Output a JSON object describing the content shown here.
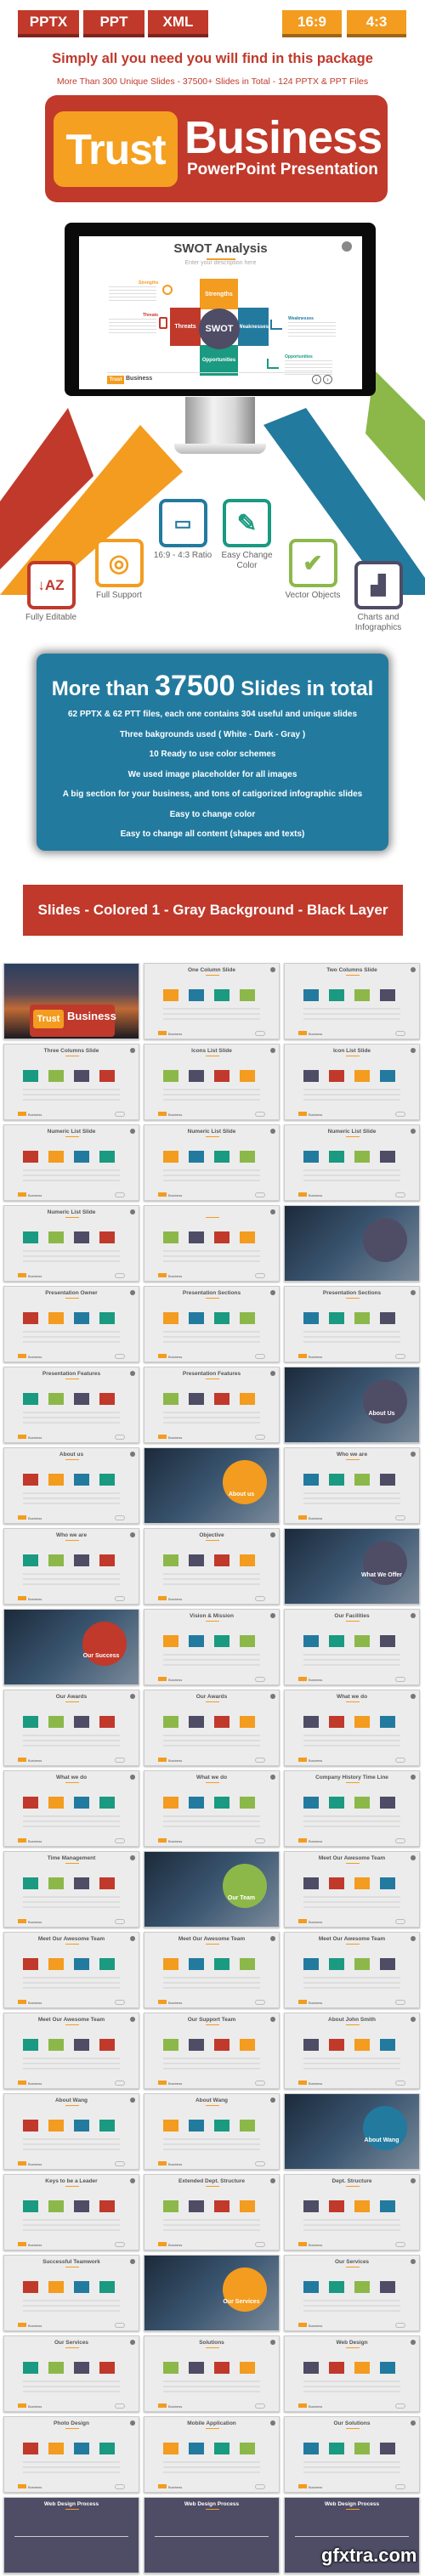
{
  "format_badges": [
    {
      "label": "PPTX",
      "color": "#c0392b"
    },
    {
      "label": "PPT",
      "color": "#c0392b"
    },
    {
      "label": "XML",
      "color": "#c0392b"
    }
  ],
  "ratio_badges": [
    {
      "label": "16:9",
      "color": "#f39c1f"
    },
    {
      "label": "4:3",
      "color": "#f39c1f"
    }
  ],
  "headline": "Simply all you need you will find in this package",
  "subheadline": "More Than 300 Unique Slides - 37500+ Slides in Total - 124 PPTX & PPT Files",
  "logo": {
    "word1": "Trust",
    "word2": "Business",
    "tagline": "PowerPoint Presentation"
  },
  "colors": {
    "red": "#c0392b",
    "orange": "#f39c1f",
    "blue": "#237a9f",
    "teal": "#1a9a80",
    "green": "#8cb84a",
    "navy": "#4f4c66"
  },
  "monitor_slide": {
    "title": "SWOT Analysis",
    "subtitle": "Enter your description here",
    "center": "SWOT",
    "blocks": {
      "top": "Strengths",
      "left": "Threats",
      "right": "Weaknesses",
      "bottom": "Opportunities"
    },
    "side_labels": {
      "strengths": "Strengths",
      "threats": "Threats",
      "weaknesses": "Weaknesses",
      "opportunities": "Opportunities"
    },
    "footer_logo_word1": "Trust",
    "footer_logo_word2": "Business"
  },
  "features": [
    {
      "icon": "sort-az-icon",
      "label": "Fully Editable",
      "color": "#c0392b"
    },
    {
      "icon": "lifebuoy-icon",
      "label": "Full Support",
      "color": "#f39c1f"
    },
    {
      "icon": "laptop-icon",
      "label": "16:9 - 4:3 Ratio",
      "color": "#237a9f"
    },
    {
      "icon": "paintbrush-icon",
      "label": "Easy Change Color",
      "color": "#1a9a80"
    },
    {
      "icon": "checkmark-icon",
      "label": "Vector Objects",
      "color": "#8cb84a"
    },
    {
      "icon": "bar-chart-icon",
      "label": "Charts and Infographics",
      "color": "#4f4c66"
    }
  ],
  "info_box": {
    "title_pre": "More than",
    "title_number": "37500",
    "title_post": "Slides in total",
    "lines": [
      "62 PPTX & 62 PTT files, each one contains 304 useful and unique slides",
      "Three bakgrounds used  ( White - Dark - Gray )",
      "10 Ready to use color schemes",
      "We used image placeholder for all images",
      "A big section for your business, and tons of catigorized infographic slides",
      "Easy to change color",
      "Easy to change all content (shapes and texts)"
    ]
  },
  "section_title": "Slides - Colored 1 - Gray Background - Black Layer",
  "slides": [
    {
      "title": "",
      "kind": "cover"
    },
    {
      "title": "One Column Slide"
    },
    {
      "title": "Two Columns Slide"
    },
    {
      "title": "Three Columns Slide"
    },
    {
      "title": "Icons List Slide"
    },
    {
      "title": "Icon List Slide"
    },
    {
      "title": "Numeric List Slide"
    },
    {
      "title": "Numeric List Slide"
    },
    {
      "title": "Numeric List Slide"
    },
    {
      "title": "Numeric List Slide"
    },
    {
      "title": ""
    },
    {
      "title": "",
      "kind": "photo"
    },
    {
      "title": "Presentation Owner"
    },
    {
      "title": "Presentation Sections"
    },
    {
      "title": "Presentation Sections"
    },
    {
      "title": "Presentation Features"
    },
    {
      "title": "Presentation Features"
    },
    {
      "title": "About Us",
      "kind": "photo"
    },
    {
      "title": "About us"
    },
    {
      "title": "About us",
      "kind": "photo"
    },
    {
      "title": "Who we are"
    },
    {
      "title": "Who we are"
    },
    {
      "title": "Objective"
    },
    {
      "title": "What We Offer",
      "kind": "photo"
    },
    {
      "title": "Our Success",
      "kind": "photo"
    },
    {
      "title": "Vision & Mission"
    },
    {
      "title": "Our Facilities"
    },
    {
      "title": "Our Awards"
    },
    {
      "title": "Our Awards"
    },
    {
      "title": "What we do"
    },
    {
      "title": "What we do"
    },
    {
      "title": "What we do"
    },
    {
      "title": "Company History Time Line"
    },
    {
      "title": "Time Management"
    },
    {
      "title": "Our Team",
      "kind": "photo"
    },
    {
      "title": "Meet Our Awesome Team"
    },
    {
      "title": "Meet Our Awesome Team"
    },
    {
      "title": "Meet Our Awesome Team"
    },
    {
      "title": "Meet Our Awesome Team"
    },
    {
      "title": "Meet Our Awesome Team"
    },
    {
      "title": "Our Support Team"
    },
    {
      "title": "About John Smith"
    },
    {
      "title": "About Wang"
    },
    {
      "title": "About Wang"
    },
    {
      "title": "About Wang",
      "kind": "photo"
    },
    {
      "title": "Keys to be a Leader"
    },
    {
      "title": "Extended Dept. Structure"
    },
    {
      "title": "Dept. Structure"
    },
    {
      "title": "Successful Teamwork"
    },
    {
      "title": "Our Services",
      "kind": "photo"
    },
    {
      "title": "Our Services"
    },
    {
      "title": "Our Services"
    },
    {
      "title": "Solutions"
    },
    {
      "title": "Web Design"
    },
    {
      "title": "Photo Design"
    },
    {
      "title": "Mobile Application"
    },
    {
      "title": "Our Solutions"
    },
    {
      "title": "Web Design Process",
      "kind": "dark"
    },
    {
      "title": "Web Design Process",
      "kind": "dark"
    },
    {
      "title": "Web Design Process",
      "kind": "dark"
    }
  ],
  "watermark": "gfxtra.com"
}
